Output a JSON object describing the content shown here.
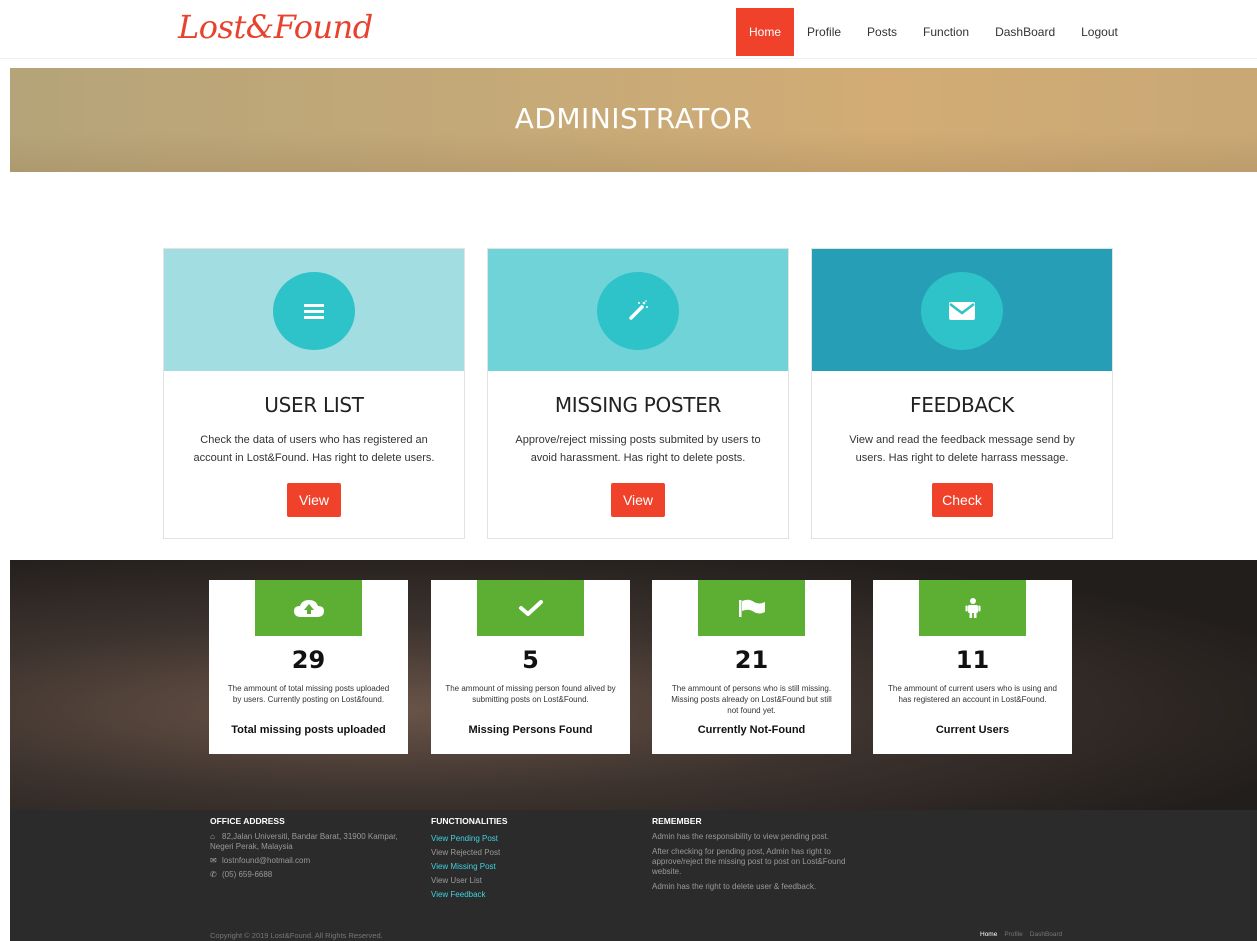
{
  "brand": {
    "logo": "Lost&Found"
  },
  "nav": {
    "items": [
      "Home",
      "Profile",
      "Posts",
      "Function",
      "DashBoard",
      "Logout"
    ],
    "active": "Home"
  },
  "banner": {
    "title": "ADMINISTRATOR"
  },
  "cards": [
    {
      "icon": "list-icon",
      "title": "USER LIST",
      "text": "Check the data of users who has registered an account in Lost&Found. Has right to delete users.",
      "button": "View",
      "top_color": "#a2dde1"
    },
    {
      "icon": "magic-wand-icon",
      "title": "MISSING POSTER",
      "text": "Approve/reject missing posts submited by users to avoid harassment. Has right to delete posts.",
      "button": "View",
      "top_color": "#6fd3d7"
    },
    {
      "icon": "envelope-icon",
      "title": "FEEDBACK",
      "text": "View and read the feedback message send by users. Has right to delete harrass message.",
      "button": "Check",
      "top_color": "#259eb6"
    }
  ],
  "stats": [
    {
      "icon": "cloud-upload-icon",
      "number": "29",
      "desc": "The ammount of total missing posts uploaded by users. Currently posting on Lost&found.",
      "label": "Total missing posts uploaded"
    },
    {
      "icon": "check-icon",
      "number": "5",
      "desc": "The ammount of missing person found alived by submitting posts on Lost&Found.",
      "label": "Missing Persons Found"
    },
    {
      "icon": "flag-icon",
      "number": "21",
      "desc": "The ammount of persons who is still missing. Missing posts already on Lost&Found but still not found yet.",
      "label": "Currently Not-Found"
    },
    {
      "icon": "person-icon",
      "number": "11",
      "desc": "The ammount of current users who is using and has registered an account in Lost&Found.",
      "label": "Current Users"
    }
  ],
  "footer": {
    "office": {
      "heading": "OFFICE ADDRESS",
      "address": "82,Jalan Universiti, Bandar Barat, 31900 Kampar, Negeri Perak, Malaysia",
      "email": "lostnfound@hotmail.com",
      "phone": "(05) 659-6688"
    },
    "functions": {
      "heading": "FUNCTIONALITIES",
      "links": [
        "View Pending Post",
        "View Rejected Post",
        "View Missing Post",
        "View User List",
        "View Feedback"
      ]
    },
    "remember": {
      "heading": "REMEMBER",
      "lines": [
        "Admin has the responsibility to view pending post.",
        "After checking for pending post, Admin has right to approve/reject the missing post to post on Lost&Found website.",
        "Admin has the right to delete user & feedback."
      ]
    },
    "copyright": "Copyright © 2019 Lost&Found. All Rights Reserved.",
    "nav": [
      "Home",
      "Profile",
      "DashBoard"
    ]
  },
  "colors": {
    "accent": "#f0412b",
    "teal_circle": "#2ec3c9",
    "green": "#5daf34",
    "link_highlight": "#3fd2e0"
  }
}
